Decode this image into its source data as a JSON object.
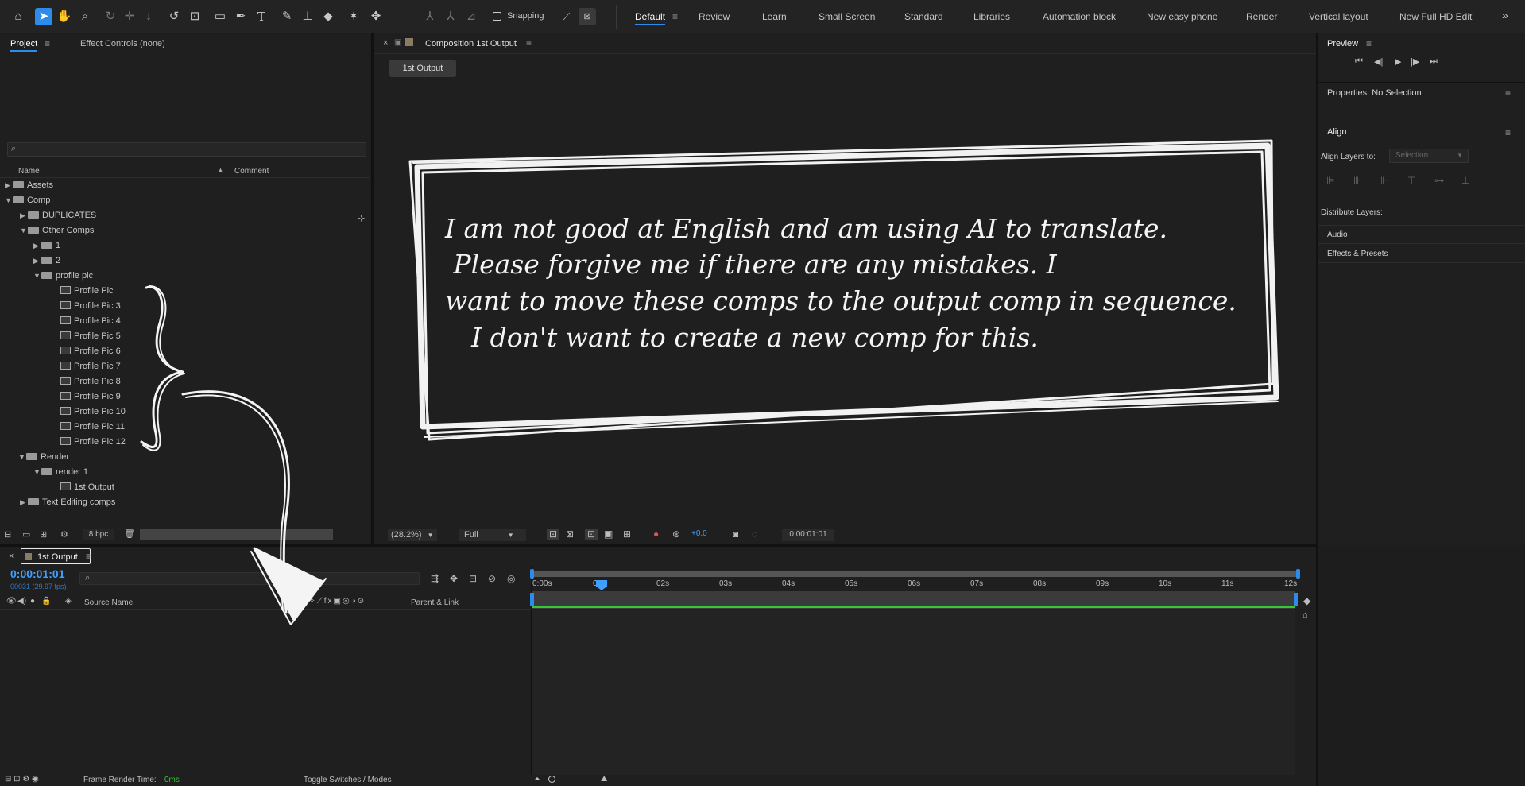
{
  "toolbar": {
    "tools": [
      "home-icon",
      "selection-tool-icon",
      "hand-tool-icon",
      "zoom-tool-icon",
      "orbit-camera-icon",
      "move-camera-icon",
      "dolly-camera-icon",
      "rotation-tool-icon",
      "pan-behind-icon",
      "rectangle-tool-icon",
      "pen-tool-icon",
      "type-tool-icon",
      "brush-tool-icon",
      "clone-stamp-icon",
      "eraser-tool-icon",
      "roto-brush-icon",
      "puppet-pin-icon"
    ],
    "snapping_label": "Snapping",
    "workspaces": [
      "Default",
      "Review",
      "Learn",
      "Small Screen",
      "Standard",
      "Libraries",
      "Automation block",
      "New easy phone",
      "Render",
      "Vertical layout",
      "New Full HD Edit"
    ],
    "overflow": "»"
  },
  "project_panel": {
    "tab_project": "Project",
    "tab_effect_controls": "Effect Controls (none)",
    "search_placeholder": "",
    "col_name": "Name",
    "col_comment": "Comment",
    "items": [
      {
        "label": "Assets"
      },
      {
        "label": "Comp"
      },
      {
        "label": "DUPLICATES"
      },
      {
        "label": "Other Comps"
      },
      {
        "label": "1"
      },
      {
        "label": "2"
      },
      {
        "label": "profile pic"
      },
      {
        "label": "Profile Pic"
      },
      {
        "label": "Profile Pic 3"
      },
      {
        "label": "Profile Pic 4"
      },
      {
        "label": "Profile Pic 5"
      },
      {
        "label": "Profile Pic 6"
      },
      {
        "label": "Profile Pic 7"
      },
      {
        "label": "Profile Pic 8"
      },
      {
        "label": "Profile Pic 9"
      },
      {
        "label": "Profile Pic 10"
      },
      {
        "label": "Profile Pic 11"
      },
      {
        "label": "Profile Pic 12"
      },
      {
        "label": "Render"
      },
      {
        "label": "render 1"
      },
      {
        "label": "1st Output"
      },
      {
        "label": "Text Editing comps"
      }
    ],
    "bpc": "8 bpc"
  },
  "composition_panel": {
    "close": "×",
    "tab_title": "Composition 1st Output",
    "breadcrumb": "1st Output",
    "overlay_text": [
      "I am not good at English and am using AI to translate.",
      "Please forgive me if there are any mistakes. I",
      "want to move these comps to the output comp in sequence.",
      "I don't want to create a new comp for this."
    ],
    "zoom": "(28.2%)",
    "resolution": "Full",
    "exposure": "+0.0",
    "timecode": "0:00:01:01"
  },
  "right_panels": {
    "preview_title": "Preview",
    "properties_title": "Properties: No Selection",
    "align_title": "Align",
    "align_layers_to_label": "Align Layers to:",
    "align_layers_to_value": "Selection",
    "distribute_layers_label": "Distribute Layers:",
    "audio_label": "Audio",
    "effects_presets_label": "Effects & Presets"
  },
  "timeline": {
    "tab_label": "1st Output",
    "timecode": "0:00:01:01",
    "frame_info": "00031 (29.97 fps)",
    "col_source_name": "Source Name",
    "col_parent_link": "Parent & Link",
    "ticks": [
      "0:00s",
      "01s",
      "02s",
      "03s",
      "04s",
      "05s",
      "06s",
      "07s",
      "08s",
      "09s",
      "10s",
      "11s",
      "12s"
    ],
    "frame_render_label": "Frame Render Time:",
    "frame_render_value": "0ms",
    "toggle_label": "Toggle Switches / Modes"
  },
  "colors": {
    "accent": "#2d8ceb",
    "timecode_blue": "#3ea0ff",
    "work_area_green": "#37c837",
    "panel_bg": "#1f1f1f"
  }
}
